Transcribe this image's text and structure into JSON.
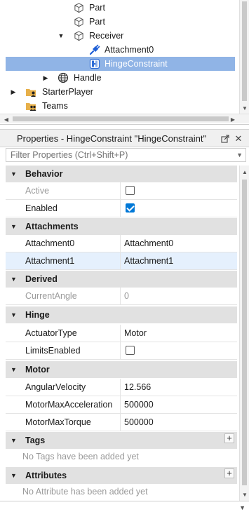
{
  "explorer": {
    "items": [
      {
        "label": "Part",
        "arrow": "",
        "icon": "part-icon"
      },
      {
        "label": "Part",
        "arrow": "",
        "icon": "part-icon"
      },
      {
        "label": "Receiver",
        "arrow": "▼",
        "icon": "part-icon"
      },
      {
        "label": "Attachment0",
        "arrow": "",
        "icon": "attachment-icon"
      },
      {
        "label": "HingeConstraint",
        "arrow": "",
        "icon": "hinge-constraint-icon",
        "selected": true
      },
      {
        "label": "Handle",
        "arrow": "▶",
        "icon": "globe-icon"
      },
      {
        "label": "StarterPlayer",
        "arrow": "▶",
        "icon": "starter-player-icon"
      },
      {
        "label": "Teams",
        "arrow": "",
        "icon": "teams-icon"
      }
    ]
  },
  "properties": {
    "title": "Properties - HingeConstraint \"HingeConstraint\"",
    "filter_placeholder": "Filter Properties (Ctrl+Shift+P)",
    "categories": {
      "behavior": {
        "label": "Behavior",
        "rows": [
          {
            "name": "Active",
            "checked": false,
            "disabled": true
          },
          {
            "name": "Enabled",
            "checked": true
          }
        ]
      },
      "attachments": {
        "label": "Attachments",
        "rows": [
          {
            "name": "Attachment0",
            "value": "Attachment0"
          },
          {
            "name": "Attachment1",
            "value": "Attachment1"
          }
        ]
      },
      "derived": {
        "label": "Derived",
        "rows": [
          {
            "name": "CurrentAngle",
            "value": "0",
            "disabled": true
          }
        ]
      },
      "hinge": {
        "label": "Hinge",
        "rows": [
          {
            "name": "ActuatorType",
            "value": "Motor"
          },
          {
            "name": "LimitsEnabled",
            "checked": false
          }
        ]
      },
      "motor": {
        "label": "Motor",
        "rows": [
          {
            "name": "AngularVelocity",
            "value": "12.566"
          },
          {
            "name": "MotorMaxAcceleration",
            "value": "500000"
          },
          {
            "name": "MotorMaxTorque",
            "value": "500000"
          }
        ]
      },
      "tags": {
        "label": "Tags",
        "empty_text": "No Tags have been added yet",
        "add_label": "+"
      },
      "attributes": {
        "label": "Attributes",
        "empty_text": "No Attribute has been added yet",
        "add_label": "+"
      }
    }
  },
  "colors": {
    "selection": "#90b4e6",
    "checkbox_on": "#0078d7",
    "category_bg": "#e1e1e1",
    "row_highlight": "#e5f0fd"
  }
}
